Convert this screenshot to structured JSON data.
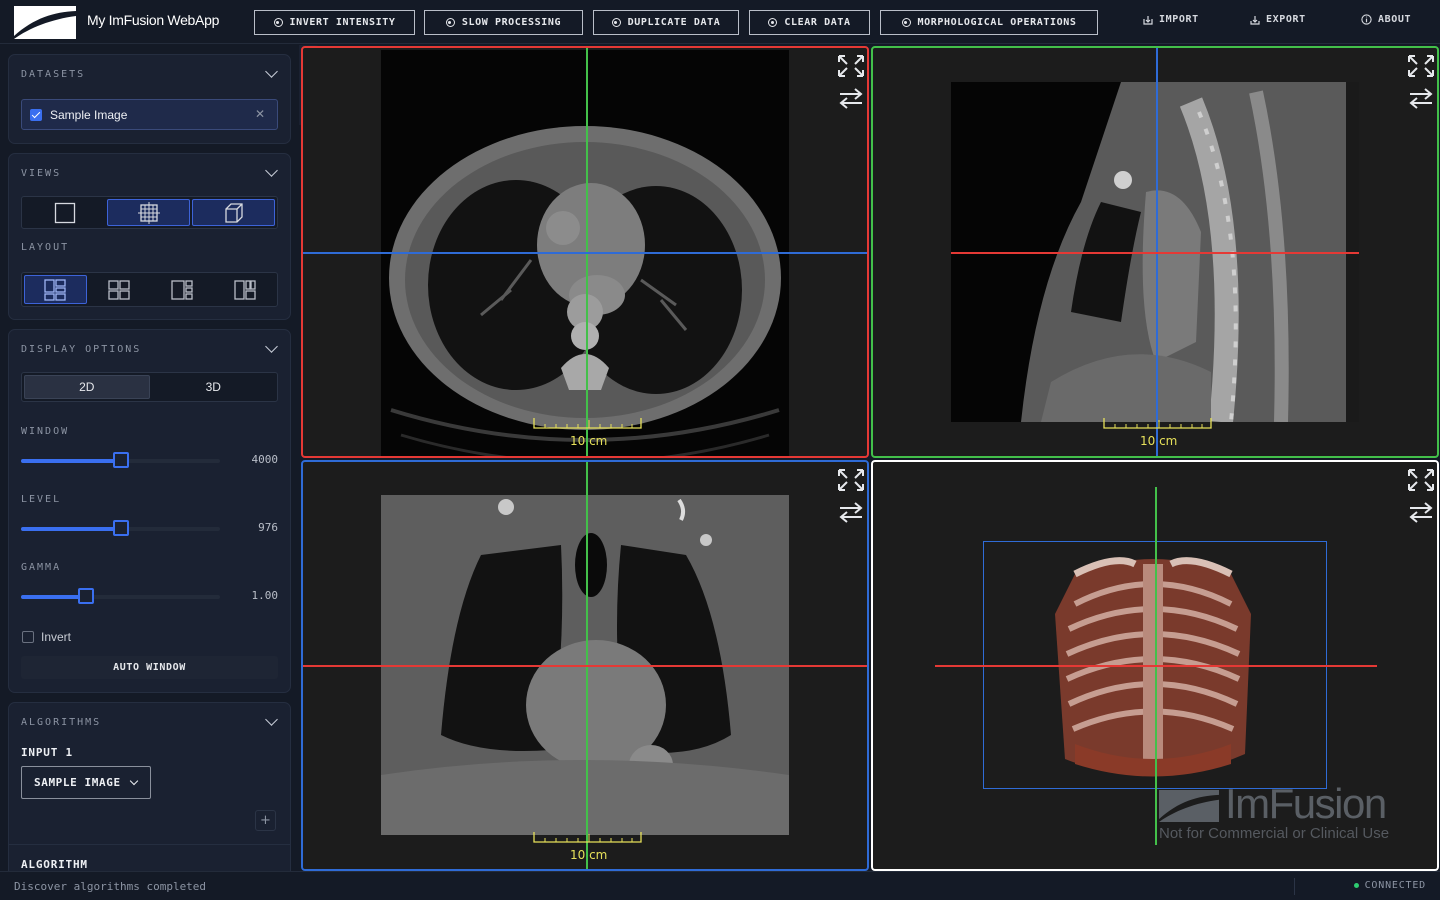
{
  "app": {
    "title": "My ImFusion WebApp"
  },
  "toolbar": {
    "buttons": [
      {
        "label": "INVERT INTENSITY"
      },
      {
        "label": "SLOW PROCESSING"
      },
      {
        "label": "DUPLICATE DATA"
      },
      {
        "label": "CLEAR DATA"
      },
      {
        "label": "MORPHOLOGICAL OPERATIONS"
      }
    ],
    "links": [
      {
        "label": "IMPORT",
        "icon": "import-icon"
      },
      {
        "label": "EXPORT",
        "icon": "export-icon"
      },
      {
        "label": "ABOUT",
        "icon": "info-icon"
      }
    ]
  },
  "sidebar": {
    "datasets": {
      "title": "DATASETS",
      "items": [
        {
          "label": "Sample Image",
          "checked": true
        }
      ]
    },
    "views": {
      "title": "VIEWS",
      "layout_label": "LAYOUT",
      "view_modes": [
        "single-view-icon",
        "crosshair-view-icon",
        "cube-view-icon"
      ],
      "active_modes": [
        1,
        2
      ],
      "layouts": [
        "layout-1-icon",
        "layout-2-icon",
        "layout-3-icon",
        "layout-4-icon"
      ],
      "active_layout": 0
    },
    "display": {
      "title": "DISPLAY OPTIONS",
      "tabs": [
        "2D",
        "3D"
      ],
      "active_tab": "2D",
      "window": {
        "label": "WINDOW",
        "value": "4000",
        "fraction": 0.5
      },
      "level": {
        "label": "LEVEL",
        "value": "976",
        "fraction": 0.5
      },
      "gamma": {
        "label": "GAMMA",
        "value": "1.00",
        "fraction": 0.33
      },
      "invert": {
        "label": "Invert",
        "checked": false
      },
      "auto_window": "AUTO WINDOW"
    },
    "algorithms": {
      "title": "ALGORITHMS",
      "input_label": "INPUT 1",
      "input_value": "SAMPLE IMAGE",
      "algorithm_label": "ALGORITHM"
    }
  },
  "viewports": {
    "scale_label": "10 cm",
    "axial_color": "#e53935",
    "sagittal_color": "#43c04a",
    "coronal_color": "#2f6bd6",
    "volume_color": "#ffffff"
  },
  "watermark": {
    "brand": "ImFusion",
    "notice": "Not for Commercial or Clinical Use"
  },
  "status": {
    "message": "Discover algorithms completed",
    "connection": "CONNECTED"
  }
}
